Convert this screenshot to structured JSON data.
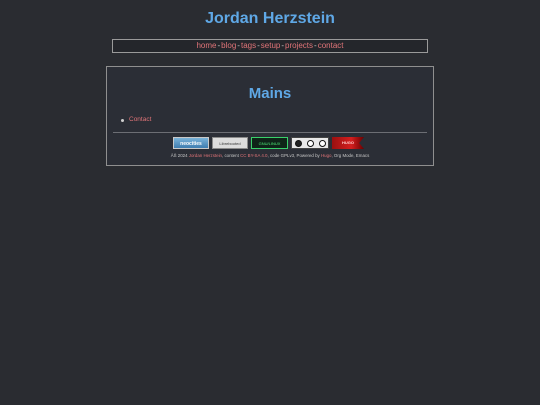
{
  "site": {
    "title": "Jordan Herzstein"
  },
  "nav": {
    "items": [
      {
        "label": "home"
      },
      {
        "label": "blog"
      },
      {
        "label": "tags"
      },
      {
        "label": "setup"
      },
      {
        "label": "projects"
      },
      {
        "label": "contact"
      }
    ],
    "separator": "-"
  },
  "main": {
    "heading": "Mains",
    "list": [
      {
        "label": "Contact"
      }
    ]
  },
  "badges": {
    "neocities": "neocities",
    "librebooting": "Librebooted",
    "gnu": "GNU/LINUX",
    "red": "HUGO"
  },
  "footer": {
    "prefix": "ÂŠ 2024",
    "author": "Jordan Herzstein",
    "content_text": ", content",
    "license": "CC BY-SA 4.0",
    "code_text": ", code GPLv3, Powered by",
    "powered": "Hugo",
    "suffix": ", Org Mode, Emacs"
  },
  "colors": {
    "background": "#2a2c31",
    "title": "#5fa8e6",
    "link": "#e07478"
  }
}
